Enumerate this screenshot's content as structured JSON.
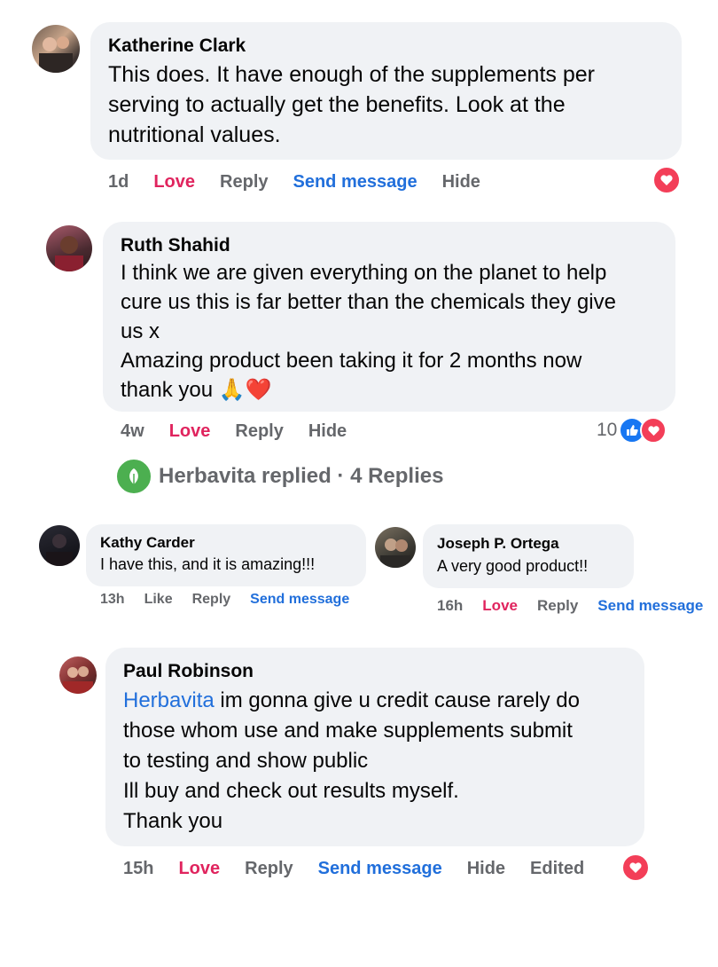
{
  "comments": [
    {
      "author": "Katherine Clark",
      "text": "This does. It have enough of the supplements per\nserving to actually get the benefits. Look at the\nnutritional values.",
      "time": "1d",
      "love": "Love",
      "reply": "Reply",
      "send": "Send message",
      "hide": "Hide"
    },
    {
      "author": "Ruth Shahid",
      "text": "I think we are given everything on the planet to help\ncure us this is far better than the chemicals they give\nus x\nAmazing product been taking it for 2 months now\nthank you 🙏❤️",
      "time": "4w",
      "love": "Love",
      "reply": "Reply",
      "hide": "Hide",
      "reaction_count": "10"
    },
    {
      "author": "Kathy Carder",
      "text": "I have this, and it is amazing!!!",
      "time": "13h",
      "like": "Like",
      "reply": "Reply",
      "send": "Send message"
    },
    {
      "author": "Joseph P. Ortega",
      "text": "A very good product!!",
      "time": "16h",
      "love": "Love",
      "reply": "Reply",
      "send": "Send message"
    },
    {
      "author": "Paul Robinson",
      "mention": "Herbavita",
      "text": " im gonna give u credit cause rarely do\nthose whom use and make supplements submit\nto testing and show public\nIll buy and check out results myself.\nThank you",
      "time": "15h",
      "love": "Love",
      "reply": "Reply",
      "send": "Send message",
      "hide": "Hide",
      "edited": "Edited"
    }
  ],
  "replies_link": {
    "text": "Herbavita replied · 4 Replies"
  },
  "colors": {
    "bubble": "#f0f2f5",
    "love": "#e0245e",
    "link": "#216fdb",
    "meta": "#65676b",
    "herbavita_green": "#4caf50"
  },
  "icons": [
    "avatar",
    "love-reaction-icon",
    "like-reaction-icon",
    "leaf-logo-icon"
  ]
}
